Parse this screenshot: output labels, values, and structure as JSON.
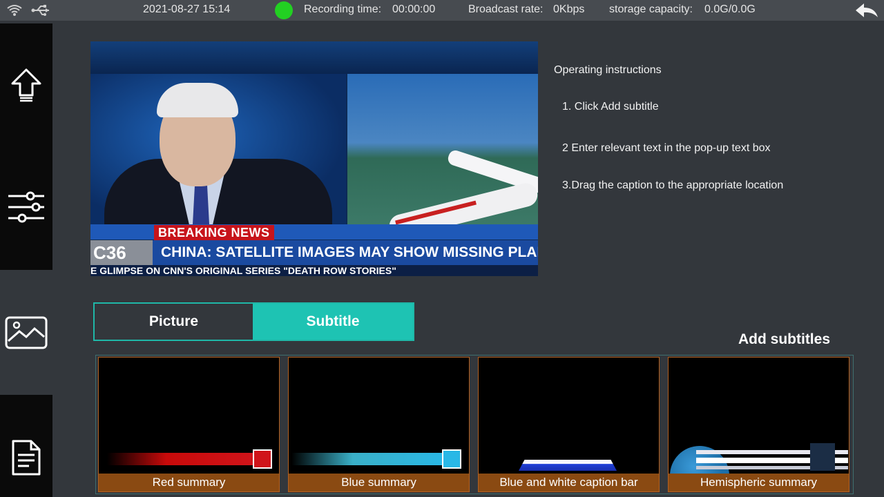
{
  "status_bar": {
    "datetime": "2021-08-27 15:14",
    "recording_label": "Recording time:",
    "recording_value": "00:00:00",
    "broadcast_label": "Broadcast rate:",
    "broadcast_value": "0Kbps",
    "storage_label": "storage capacity:",
    "storage_value": "0.0G/0.0G",
    "record_indicator_color": "#22d022"
  },
  "sidebar": {
    "items": [
      {
        "icon": "upload-arrow-icon"
      },
      {
        "icon": "sliders-icon"
      },
      {
        "icon": "image-icon"
      },
      {
        "icon": "document-icon"
      }
    ]
  },
  "preview": {
    "breaking": "BREAKING NEWS",
    "channel_logo": "C36",
    "headline": "CHINA: SATELLITE IMAGES MAY SHOW MISSING PLANE",
    "ticker": "E GLIMPSE ON CNN'S ORIGINAL SERIES \"DEATH ROW STORIES\""
  },
  "instructions": {
    "title": "Operating instructions",
    "steps": [
      "1. Click Add subtitle",
      "2 Enter relevant text in the pop-up text box",
      "3.Drag the caption to the appropriate location"
    ]
  },
  "tabs": {
    "picture": "Picture",
    "subtitle": "Subtitle",
    "active": "Subtitle",
    "active_color": "#1ec3b3"
  },
  "add_subtitles": "Add subtitles",
  "templates": [
    {
      "label": "Red summary",
      "color": "#d0141a"
    },
    {
      "label": "Blue summary",
      "color": "#29b8e6"
    },
    {
      "label": "Blue and white caption bar",
      "color": "#1f3fd8"
    },
    {
      "label": "Hemispheric summary",
      "color": "#1e6fa8"
    }
  ]
}
